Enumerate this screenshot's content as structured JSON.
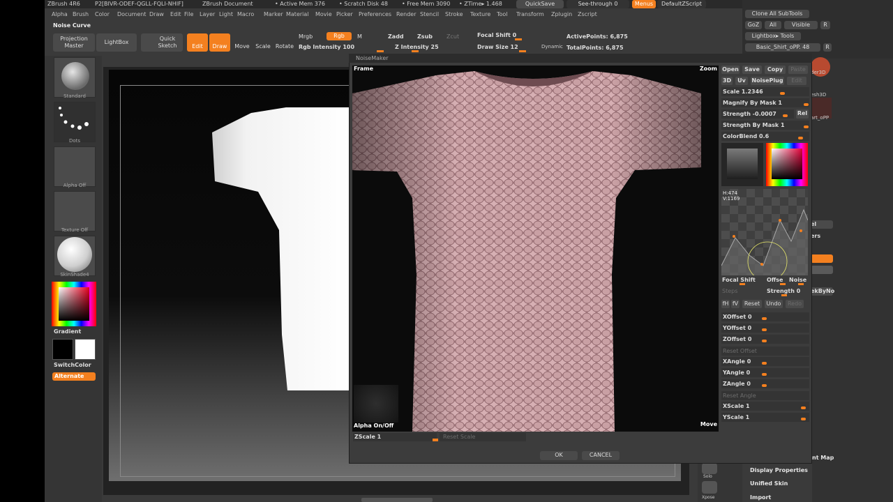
{
  "titlebar": {
    "app": "ZBrush 4R6",
    "doc_id": "P2[BIVR-ODEF-QGLL-FQLI-NHIF]",
    "document": "ZBrush Document",
    "active_mem": "• Active Mem 376",
    "scratch_disk": "• Scratch Disk 48",
    "free_mem": "• Free Mem 3090",
    "ztime": "• ZTime▸ 1.468",
    "quicksave": "QuickSave",
    "seethrough": "See-through   0",
    "menus": "Menus",
    "defaultzscript": "DefaultZScript"
  },
  "menubar": [
    "Alpha",
    "Brush",
    "Color",
    "Document",
    "Draw",
    "Edit",
    "File",
    "Layer",
    "Light",
    "Macro",
    "Marker",
    "Material",
    "Movie",
    "Picker",
    "Preferences",
    "Render",
    "Stencil",
    "Stroke",
    "Texture",
    "Tool",
    "Transform",
    "Zplugin",
    "Zscript"
  ],
  "tool_hint": "Noise Curve",
  "toolbar": {
    "projection_master": "Projection Master",
    "lightbox": "LightBox",
    "quick_sketch": "Quick Sketch",
    "edit": "Edit",
    "draw": "Draw",
    "move": "Move",
    "scale": "Scale",
    "rotate": "Rotate",
    "mrgb": "Mrgb",
    "rgb": "Rgb",
    "m": "M",
    "rgb_intensity": "Rgb Intensity 100",
    "zadd": "Zadd",
    "zsub": "Zsub",
    "zcut": "Zcut",
    "z_intensity": "Z Intensity 25",
    "focal_shift": "Focal Shift 0",
    "draw_size": "Draw Size 12",
    "dynamic": "Dynamic",
    "active_points": "ActivePoints: 6,875",
    "total_points": "TotalPoints: 6,875"
  },
  "top_right": {
    "clone_all": "Clone All SubTools",
    "goz": "GoZ",
    "all": "All",
    "visible": "Visible",
    "r": "R",
    "lightbox_tools": "Lightbox▸ Tools",
    "shirt": "Basic_Shirt_oPP. 48",
    "r2": "R"
  },
  "left_shelf": {
    "standard": "Standard",
    "dots": "Dots",
    "alpha_off": "Alpha Off",
    "texture_off": "Texture Off",
    "material": "SkinShade4",
    "gradient": "Gradient",
    "switchcolor": "SwitchColor",
    "alternate": "Alternate"
  },
  "noisemaker": {
    "title": "NoiseMaker",
    "frame": "Frame",
    "zoom": "Zoom",
    "alpha_onoff": "Alpha On/Off",
    "move": "Move",
    "zscale": "ZScale 1",
    "reset_scale": "Reset Scale",
    "ok": "OK",
    "cancel": "CANCEL",
    "open": "Open",
    "save": "Save",
    "copy": "Copy",
    "paste": "Paste",
    "3d": "3D",
    "uv": "Uv",
    "noiseplug": "NoisePlug",
    "edit": "Edit",
    "scale": "Scale 1.2346",
    "magnify_by_mask": "Magnify By Mask 1",
    "strength": "Strength -0.0007",
    "rel": "Rel",
    "strength_by_mask": "Strength By Mask 1",
    "colorblend": "ColorBlend 0.6",
    "h": "H:474",
    "v": "V:1169",
    "focal_shift": "Focal Shift",
    "offset": "Offse",
    "noise": "Noise",
    "steps": "Steps",
    "strength2": "Strength 0",
    "fh": "fH",
    "fv": "fV",
    "reset": "Reset",
    "undo": "Undo",
    "redo": "Redo",
    "xoffset": "XOffset 0",
    "yoffset": "YOffset 0",
    "zoffset": "ZOffset 0",
    "reset_offset": "Reset Offset",
    "xangle": "XAngle 0",
    "yangle": "YAngle 0",
    "zangle": "ZAngle 0",
    "reset_angle": "Reset Angle",
    "xscale": "XScale 1",
    "yscale": "YScale 1"
  },
  "right_panel": {
    "el": "el",
    "ers": "ers",
    "ekbyno": "ekByNo",
    "solo": "Solo",
    "xpose": "Xpose",
    "nt_map": "nt Map",
    "display_properties": "Display Properties",
    "unified_skin": "Unified Skin",
    "import": "Import",
    "der3d": "der3D",
    "esh3d": "esh3D",
    "art_opp": "art_oPP"
  },
  "colors": {
    "accent": "#f4801f",
    "panel": "#3a3a3a",
    "shirt": "#b98a8e"
  }
}
